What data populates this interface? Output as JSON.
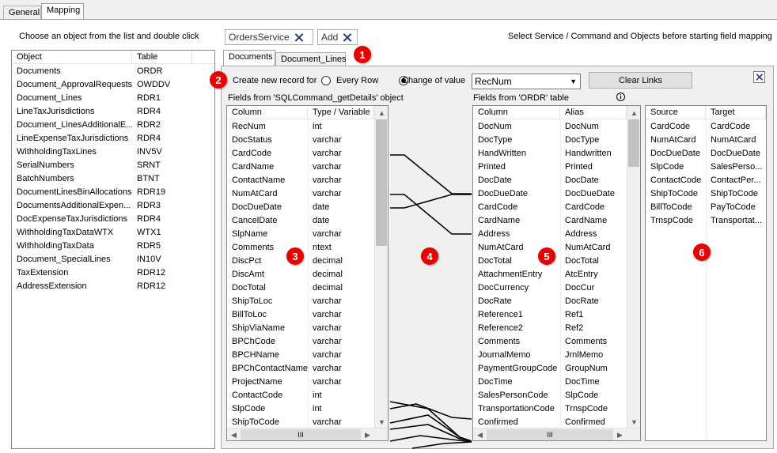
{
  "tabs": {
    "general": "General",
    "mapping": "Mapping"
  },
  "object_list": {
    "instruction": "Choose an object from the list and double click",
    "columns": [
      "Object",
      "Table"
    ],
    "rows": [
      [
        "Documents",
        "ORDR"
      ],
      [
        "Document_ApprovalRequests",
        "OWDDV"
      ],
      [
        "Document_Lines",
        "RDR1"
      ],
      [
        "LineTaxJurisdictions",
        "RDR4"
      ],
      [
        "Document_LinesAdditionalE...",
        "RDR2"
      ],
      [
        "LineExpenseTaxJurisdictions",
        "RDR4"
      ],
      [
        "WithholdingTaxLines",
        "INV5V"
      ],
      [
        "SerialNumbers",
        "SRNT"
      ],
      [
        "BatchNumbers",
        "BTNT"
      ],
      [
        "DocumentLinesBinAllocations",
        "RDR19"
      ],
      [
        "DocumentsAdditionalExpen...",
        "RDR3"
      ],
      [
        "DocExpenseTaxJurisdictions",
        "RDR4"
      ],
      [
        "WithholdingTaxDataWTX",
        "WTX1"
      ],
      [
        "WithholdingTaxData",
        "RDR5"
      ],
      [
        "Document_SpecialLines",
        "IN10V"
      ],
      [
        "TaxExtension",
        "RDR12"
      ],
      [
        "AddressExtension",
        "RDR12"
      ]
    ]
  },
  "tokens": {
    "service": "OrdersService",
    "command": "Add"
  },
  "hint": "Select Service / Command and Objects before starting field mapping",
  "subtabs": {
    "documents": "Documents",
    "document_lines": "Document_Lines"
  },
  "options": {
    "create_label": "Create new record for",
    "every_row": "Every Row",
    "change_of_value": "Change of value",
    "selected_field": "RecNum",
    "clear_links": "Clear Links"
  },
  "source_fields": {
    "title": "Fields from 'SQLCommand_getDetails' object",
    "columns": [
      "Column",
      "Type / Variable"
    ],
    "rows": [
      [
        "RecNum",
        "int"
      ],
      [
        "DocStatus",
        "varchar"
      ],
      [
        "CardCode",
        "varchar"
      ],
      [
        "CardName",
        "varchar"
      ],
      [
        "ContactName",
        "varchar"
      ],
      [
        "NumAtCard",
        "varchar"
      ],
      [
        "DocDueDate",
        "date"
      ],
      [
        "CancelDate",
        "date"
      ],
      [
        "SlpName",
        "varchar"
      ],
      [
        "Comments",
        "ntext"
      ],
      [
        "DiscPct",
        "decimal"
      ],
      [
        "DiscAmt",
        "decimal"
      ],
      [
        "DocTotal",
        "decimal"
      ],
      [
        "ShipToLoc",
        "varchar"
      ],
      [
        "BillToLoc",
        "varchar"
      ],
      [
        "ShipViaName",
        "varchar"
      ],
      [
        "BPChCode",
        "varchar"
      ],
      [
        "BPCHName",
        "varchar"
      ],
      [
        "BPChContactName",
        "varchar"
      ],
      [
        "ProjectName",
        "varchar"
      ],
      [
        "ContactCode",
        "int"
      ],
      [
        "SlpCode",
        "int"
      ],
      [
        "ShipToCode",
        "varchar"
      ]
    ]
  },
  "target_fields": {
    "title": "Fields from 'ORDR' table",
    "info_icon": "info-icon",
    "columns": [
      "Column",
      "Alias"
    ],
    "rows": [
      [
        "DocNum",
        "DocNum"
      ],
      [
        "DocType",
        "DocType"
      ],
      [
        "HandWritten",
        "Handwritten"
      ],
      [
        "Printed",
        "Printed"
      ],
      [
        "DocDate",
        "DocDate"
      ],
      [
        "DocDueDate",
        "DocDueDate"
      ],
      [
        "CardCode",
        "CardCode"
      ],
      [
        "CardName",
        "CardName"
      ],
      [
        "Address",
        "Address"
      ],
      [
        "NumAtCard",
        "NumAtCard"
      ],
      [
        "DocTotal",
        "DocTotal"
      ],
      [
        "AttachmentEntry",
        "AtcEntry"
      ],
      [
        "DocCurrency",
        "DocCur"
      ],
      [
        "DocRate",
        "DocRate"
      ],
      [
        "Reference1",
        "Ref1"
      ],
      [
        "Reference2",
        "Ref2"
      ],
      [
        "Comments",
        "Comments"
      ],
      [
        "JournalMemo",
        "JrnlMemo"
      ],
      [
        "PaymentGroupCode",
        "GroupNum"
      ],
      [
        "DocTime",
        "DocTime"
      ],
      [
        "SalesPersonCode",
        "SlpCode"
      ],
      [
        "TransportationCode",
        "TrnspCode"
      ],
      [
        "Confirmed",
        "Confirmed"
      ]
    ]
  },
  "mappings": {
    "columns": [
      "Source",
      "Target"
    ],
    "rows": [
      [
        "CardCode",
        "CardCode"
      ],
      [
        "NumAtCard",
        "NumAtCard"
      ],
      [
        "DocDueDate",
        "DocDueDate"
      ],
      [
        "SlpCode",
        "SalesPerso..."
      ],
      [
        "ContactCode",
        "ContactPer..."
      ],
      [
        "ShipToCode",
        "ShipToCode"
      ],
      [
        "BillToCode",
        "PayToCode"
      ],
      [
        "TrnspCode",
        "Transportat..."
      ]
    ]
  },
  "badges": [
    "1",
    "2",
    "3",
    "4",
    "5",
    "6"
  ],
  "scroll": {
    "up": "▲",
    "down": "▼",
    "left": "◀",
    "right": "▶",
    "thumb": "III"
  }
}
